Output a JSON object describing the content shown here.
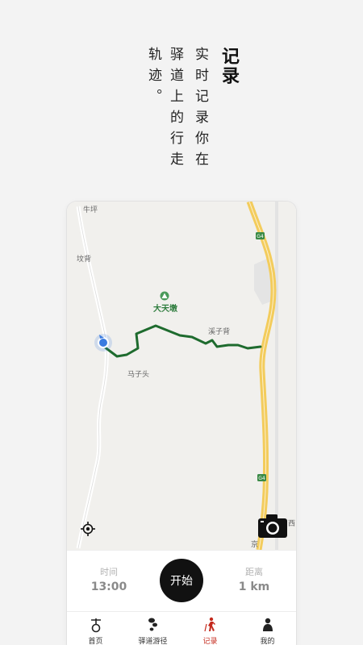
{
  "headline": {
    "title": "记录",
    "col1": "实时记录你在",
    "col2": "驿道上的行走",
    "col3": "轨迹。"
  },
  "map": {
    "places": {
      "niuping": "牛坪",
      "wenbei": "坟背",
      "datiandun": "大天墩",
      "xizibei": "溪子背",
      "mazitou": "马子头",
      "xi": "西",
      "jing": "京"
    },
    "highway_shields": [
      "G4",
      "G4"
    ],
    "track_color": "#1e6b2e",
    "highway_color": "#f3cc5c"
  },
  "controls": {
    "time_label": "时间",
    "time_value": "13:00",
    "start_label": "开始",
    "distance_label": "距离",
    "distance_value": "1 km"
  },
  "tabs": [
    {
      "label": "首页",
      "icon": "home-icon",
      "active": false
    },
    {
      "label": "驿道游径",
      "icon": "trail-icon",
      "active": false
    },
    {
      "label": "记录",
      "icon": "hiker-icon",
      "active": true
    },
    {
      "label": "我的",
      "icon": "user-icon",
      "active": false
    }
  ],
  "colors": {
    "accent": "#c4291c",
    "start_button": "#111111"
  }
}
